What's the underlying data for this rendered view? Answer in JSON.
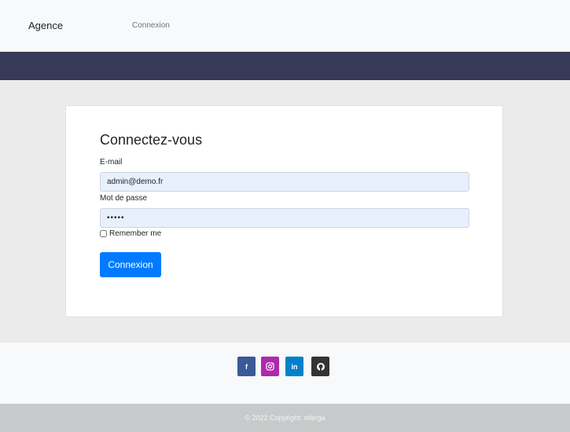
{
  "navbar": {
    "brand": "Agence",
    "link": "Connexion"
  },
  "login": {
    "title": "Connectez-vous",
    "email_label": "E-mail",
    "email_value": "admin@demo.fr",
    "password_label": "Mot de passe",
    "password_value": "•••••",
    "remember_label": "Remember me",
    "submit_label": "Connexion"
  },
  "footer": {
    "social": [
      {
        "name": "facebook-icon",
        "glyph": "f",
        "color": "#3b5998"
      },
      {
        "name": "instagram-icon",
        "glyph": "◎",
        "color": "#ac2bac"
      },
      {
        "name": "linkedin-icon",
        "glyph": "in",
        "color": "#0082ca"
      },
      {
        "name": "github-icon",
        "glyph": "⬤",
        "color": "#333333"
      }
    ],
    "copyright": "© 2022 Copyright: siferga"
  }
}
